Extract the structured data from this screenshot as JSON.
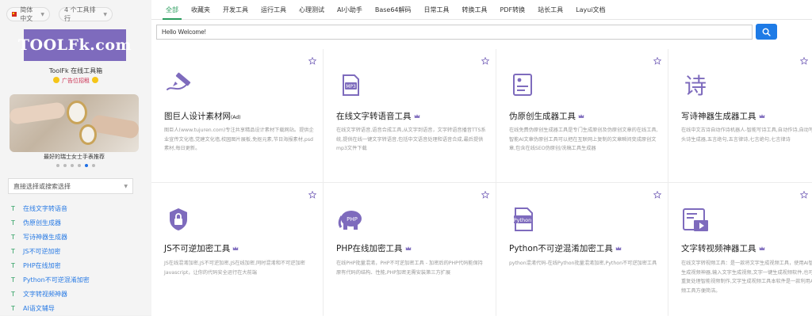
{
  "sidebar": {
    "language": "简体中文",
    "tool_rank": "4 个工具排行",
    "logo_text": "TOOLFk.com",
    "site_name": "ToolFk 在线工具箱",
    "ad_text": "广告位招租",
    "banner_caption": "最好的瑞士女士手表推荐",
    "carousel_active_index": 4,
    "search_select": "直接选择或搜索选择",
    "tools": [
      "在线文字转语音",
      "伪原创生成器",
      "写诗神器生成器",
      "JS不可逆加密",
      "PHP在线加密",
      "Python不可逆混淆加密",
      "文字转视频神器",
      "AI语文辅导"
    ]
  },
  "nav": {
    "tabs": [
      "全部",
      "收藏夹",
      "开发工具",
      "运行工具",
      "心理测试",
      "AI小助手",
      "Base64解码",
      "日常工具",
      "转换工具",
      "PDF转换",
      "站长工具",
      "Layui文档"
    ],
    "active_tab": "全部"
  },
  "search": {
    "value": "Hello Welcome!"
  },
  "cards": [
    {
      "title": "图巨人设计素材网",
      "badge": "(Ad)",
      "desc": "图巨人(www.tujuren.com)专注共享精品设计素材下载网站。提供企业宣传文化墙,党建文化墙,校园图片展板,免抠元素,节日海报素材,psd素材,每日更新。",
      "icon": "pen-brush-icon"
    },
    {
      "title": "在线文字转语音工具",
      "desc": "在线文字转语音,语音合成工具,从文字到语音，文字转语音播音TTS系统,提供在线一键文字转语音,包括中文语音处理和语音合成,最后提供mp3文件下载",
      "icon": "mp3-file-icon"
    },
    {
      "title": "伪原创生成器工具",
      "desc": "在线免费伪原创生成器工具是专门生成原创及伪原创文章的在线工具,智能AI文章伪原创工具可以把在互联网上复制的文章瞬间变成原创文章,包含在线SEO伪原创/洗稿工具生成器",
      "icon": "document-image-icon"
    },
    {
      "title": "写诗神器生成器工具",
      "desc": "在线中文古诗自动作诗机器人-智能写诗工具,自动作诗,自动写诗词,藏头诗生成器,五言绝句,五言律诗,七言绝句,七言律诗",
      "icon": "poem-character-icon"
    },
    {
      "title": "JS不可逆加密工具",
      "desc": "JS在线混淆加密,JS不可逆加密,JS在线加密,同时混淆和不可逆加密Javascript，让你的代码安全运行在大前端",
      "icon": "shield-lock-icon"
    },
    {
      "title": "PHP在线加密工具",
      "desc": "在线PHP批量混淆，PHP不可逆加密工具 - 加密后的PHP代码能保持原有代码的结构、性能,PHP加密无需安装第三方扩展",
      "icon": "php-elephant-icon"
    },
    {
      "title": "Python不可逆混淆加密工具",
      "desc": "python混淆代码-在线Python批量混淆加密,Python不可逆加密工具",
      "icon": "python-file-icon"
    },
    {
      "title": "文字转视频神器工具",
      "desc": "在线文字转视频工具：是一款将文字生成视频工具，使用AI智能文字生成视频神器,输入文字生成视频,文字一键生成视频软件,也可对内容重复处理智能视频制作,文字生成视频工具本软件是一款利用AI生成视频工具方便简洁。",
      "icon": "video-board-icon"
    }
  ],
  "colors": {
    "accent_green": "#2a9d5e",
    "link_blue": "#2a7be4",
    "button_blue": "#1e7be6",
    "icon_purple": "#7e6bbd",
    "logo_purple": "#7e6bbd"
  }
}
